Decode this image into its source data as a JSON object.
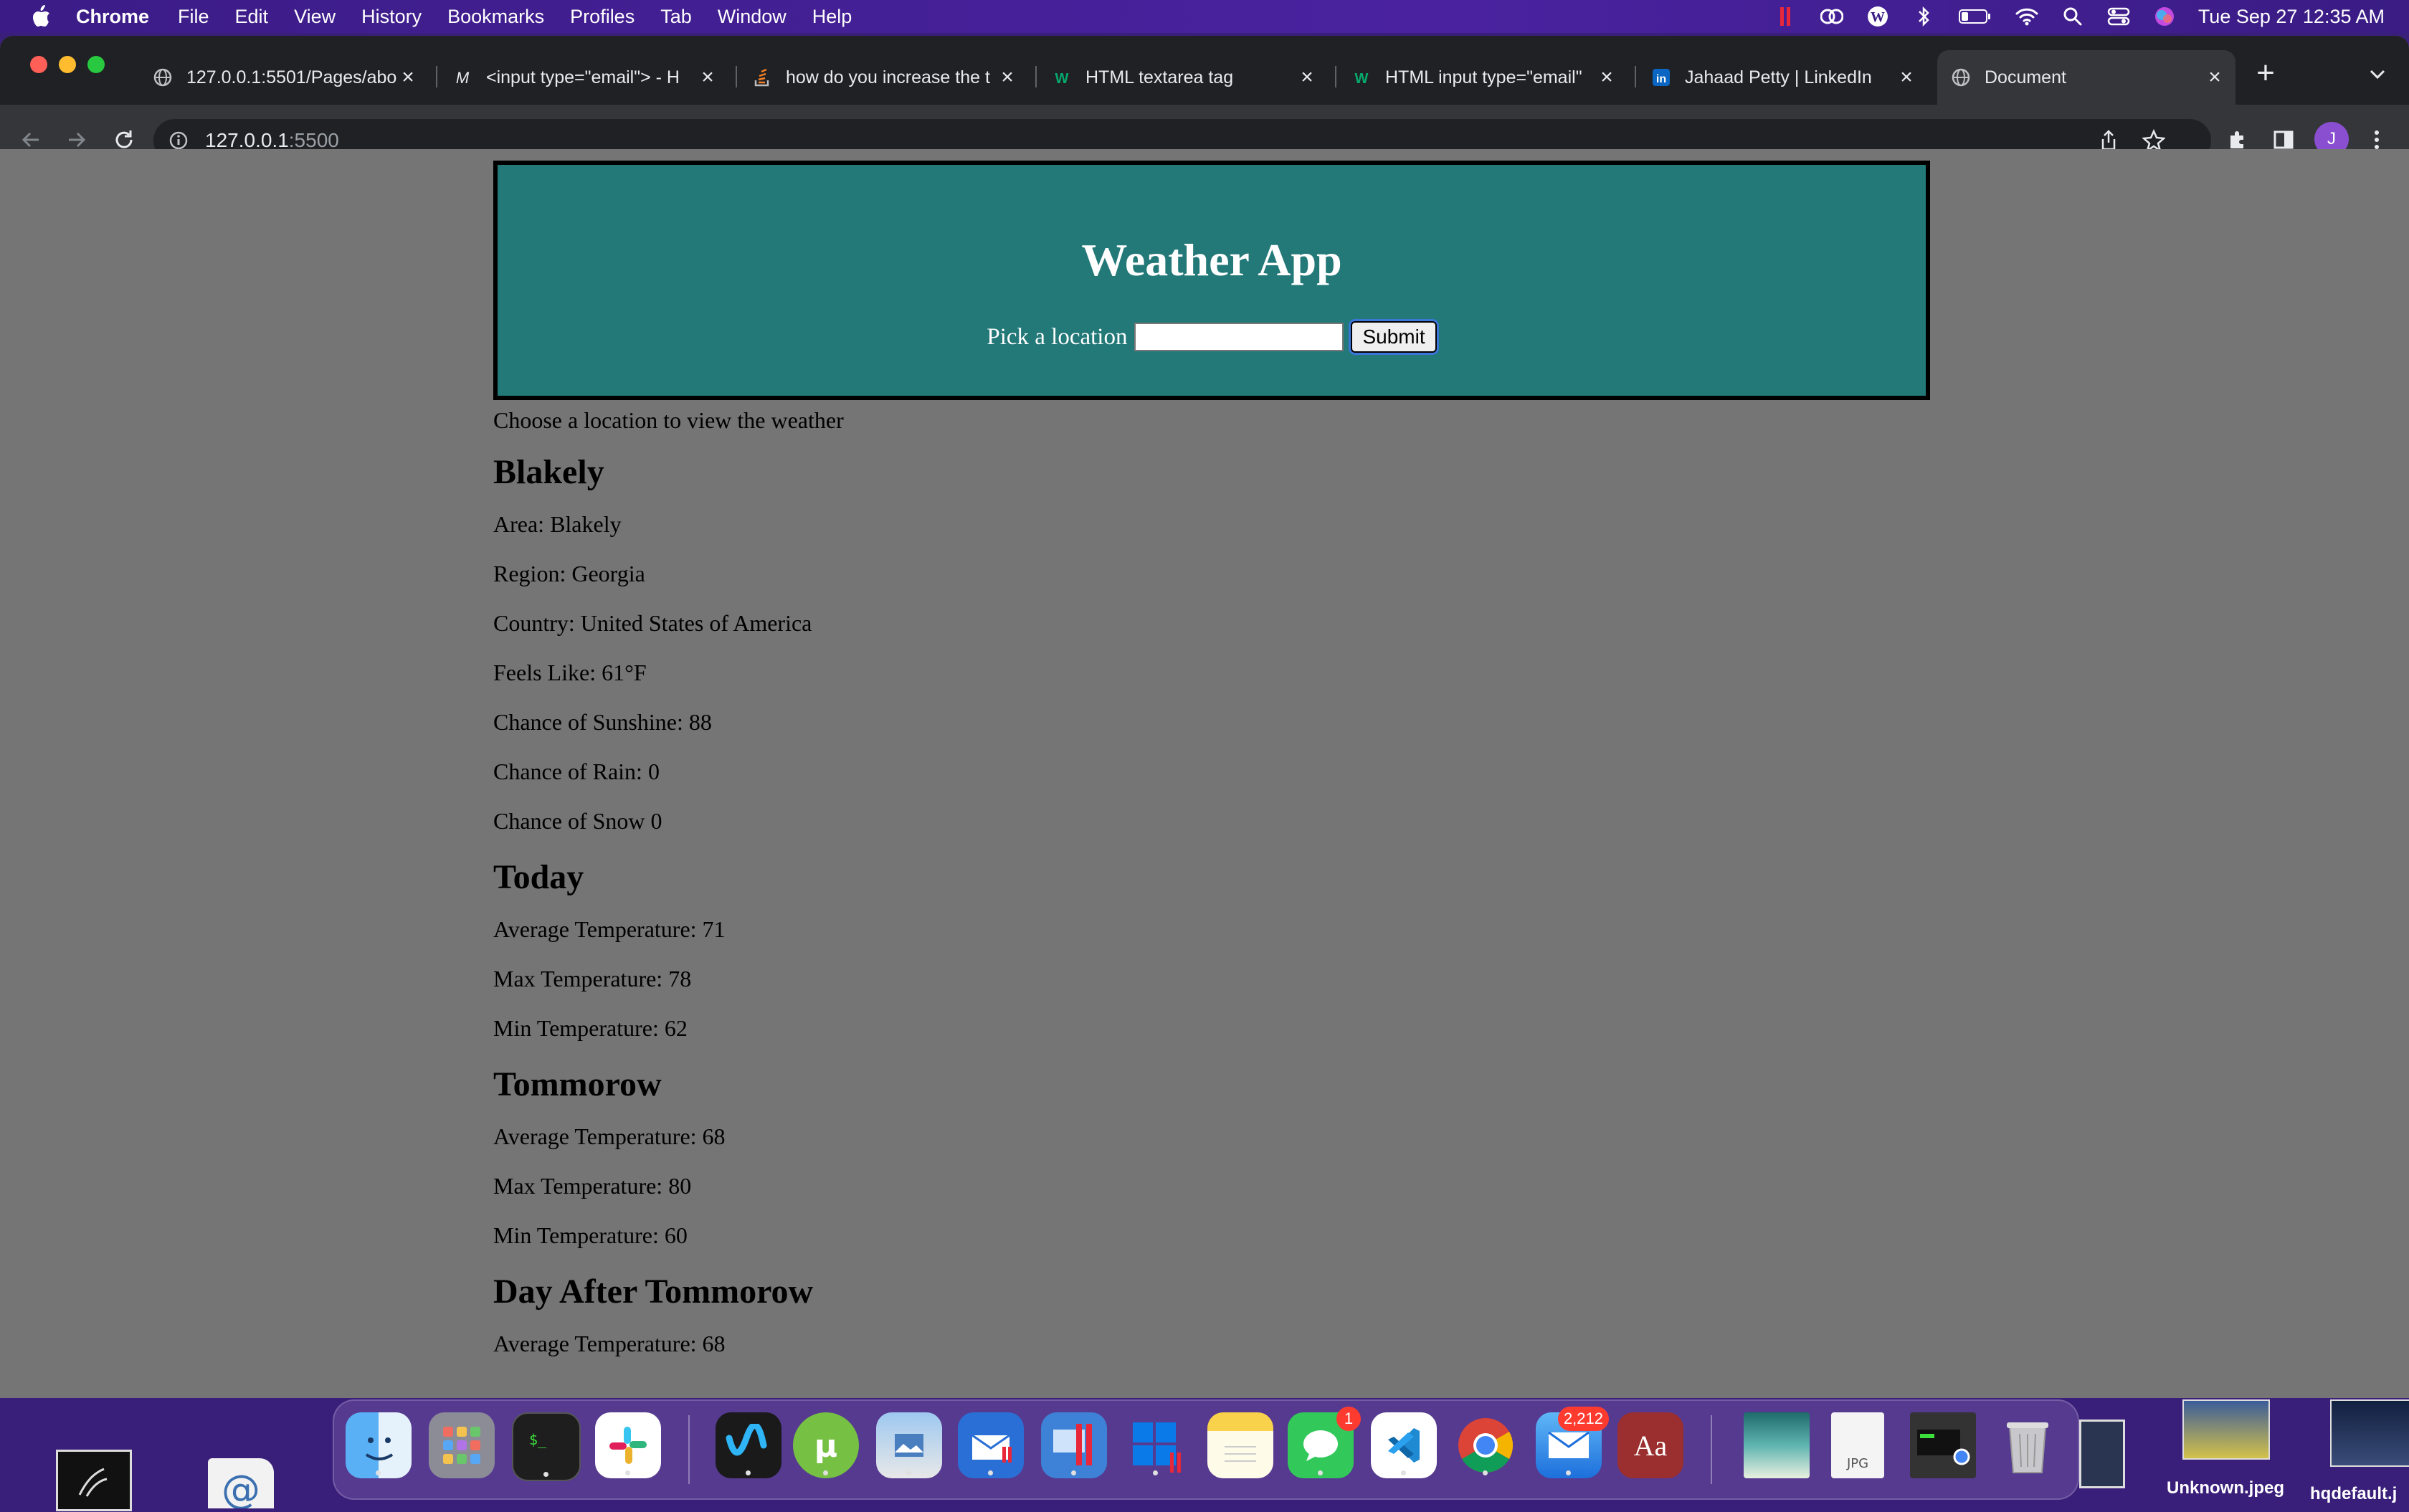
{
  "menubar": {
    "app_name": "Chrome",
    "items": [
      "File",
      "Edit",
      "View",
      "History",
      "Bookmarks",
      "Profiles",
      "Tab",
      "Window",
      "Help"
    ],
    "clock": "Tue Sep 27  12:35 AM"
  },
  "tabs": [
    {
      "title": "127.0.0.1:5501/Pages/abo",
      "icon": "globe-icon"
    },
    {
      "title": "<input type=\"email\"> - H",
      "icon": "mdn-icon"
    },
    {
      "title": "how do you increase the t",
      "icon": "stackoverflow-icon"
    },
    {
      "title": "HTML textarea tag",
      "icon": "w3schools-icon"
    },
    {
      "title": "HTML input type=\"email\"",
      "icon": "w3schools-icon"
    },
    {
      "title": "Jahaad Petty | LinkedIn",
      "icon": "linkedin-icon"
    },
    {
      "title": "Document",
      "icon": "globe-icon",
      "active": true
    }
  ],
  "address_bar": {
    "host": "127.0.0.1",
    "port": ":5500"
  },
  "profile_initial": "J",
  "page": {
    "title": "Weather App",
    "location_label": "Pick a location",
    "location_value": "",
    "submit_label": "Submit",
    "intro": "Choose a location to view the weather",
    "location_heading": "Blakely",
    "area": "Area: Blakely",
    "region": "Region: Georgia",
    "country": "Country: United States of America",
    "feels_like": "Feels Like: 61°F",
    "chance_sunshine": "Chance of Sunshine: 88",
    "chance_rain": "Chance of Rain: 0",
    "chance_snow": "Chance of Snow 0",
    "days": [
      {
        "heading": "Today",
        "avg": "Average Temperature: 71",
        "max": "Max Temperature: 78",
        "min": "Min Temperature: 62"
      },
      {
        "heading": "Tommorow",
        "avg": "Average Temperature: 68",
        "max": "Max Temperature: 80",
        "min": "Min Temperature: 60"
      },
      {
        "heading": "Day After Tommorow",
        "avg": "Average Temperature: 68"
      }
    ]
  },
  "dock": {
    "messages_badge": "1",
    "mail_badge": "2,212",
    "dictionary_label": "Aa",
    "preview_label": "JPG"
  },
  "desktop_files": [
    "Unknown.jpeg",
    "hqdefault.j"
  ],
  "colors": {
    "header_bg": "#237878",
    "page_bg": "#757575",
    "chrome_dark": "#202124",
    "chrome_toolbar": "#35363a"
  }
}
